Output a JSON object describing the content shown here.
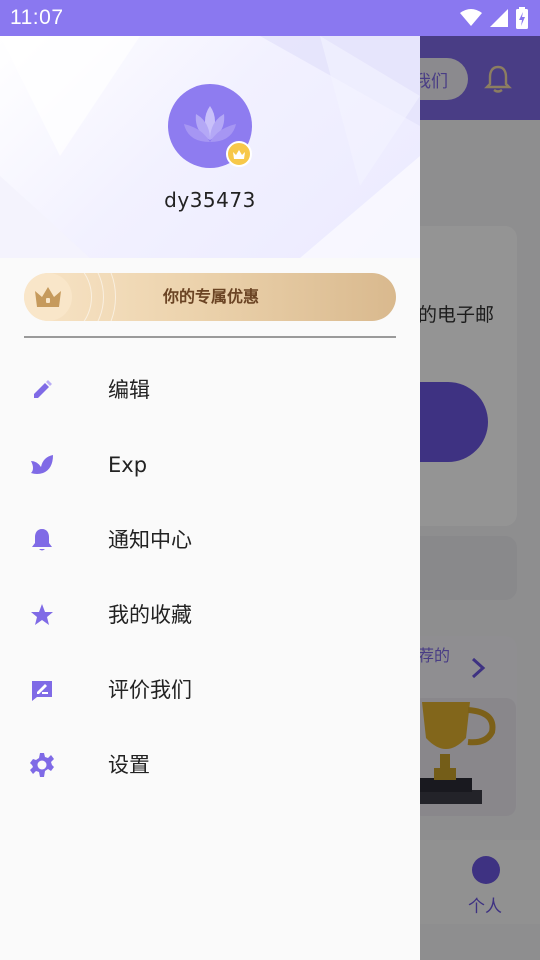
{
  "status_bar": {
    "time": "11:07"
  },
  "background": {
    "header_pill_label": "我们",
    "card_text": "的电子邮",
    "section_text": "荐的",
    "tab_label": "个人"
  },
  "profile": {
    "username": "dy35473"
  },
  "promo": {
    "label": "你的专属优惠"
  },
  "menu": [
    {
      "label": "编辑",
      "icon": "pencil-icon"
    },
    {
      "label": "Exp",
      "icon": "leaf-icon"
    },
    {
      "label": "通知中心",
      "icon": "bell-icon"
    },
    {
      "label": "我的收藏",
      "icon": "star-icon"
    },
    {
      "label": "评价我们",
      "icon": "rate-icon"
    },
    {
      "label": "设置",
      "icon": "gear-icon"
    }
  ],
  "colors": {
    "accent": "#7f6ae6",
    "status_bar": "#8a78f0",
    "promo_text": "#6b4424",
    "vip_gold": "#f7c84a"
  }
}
